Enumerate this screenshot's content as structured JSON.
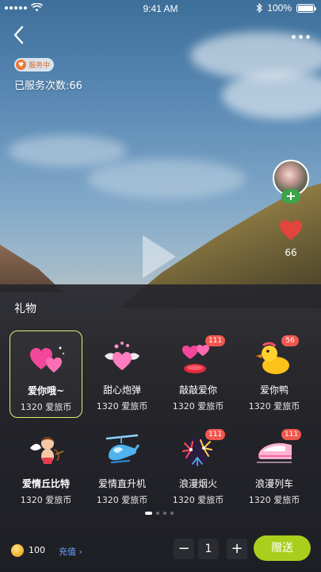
{
  "status_bar": {
    "time": "9:41 AM",
    "battery": "100%"
  },
  "profile": {
    "service_badge": "服务中",
    "service_count_label": "已服务次数:",
    "service_count": "66",
    "follow_symbol": "+",
    "like_count": "66"
  },
  "gift_panel": {
    "title": "礼物",
    "gifts": [
      {
        "name": "爱你哦~",
        "price": "1320 爱旅币",
        "icon": "double-heart-icon",
        "badge": "",
        "selected": true
      },
      {
        "name": "甜心炮弹",
        "price": "1320 爱旅币",
        "icon": "winged-heart-icon",
        "badge": ""
      },
      {
        "name": "敲敲爱你",
        "price": "1320 爱旅币",
        "icon": "heart-balloon-icon",
        "badge": "111"
      },
      {
        "name": "爱你鸭",
        "price": "1320 爱旅币",
        "icon": "duck-icon",
        "badge": "56"
      },
      {
        "name": "爱情丘比特",
        "price": "1320 爱旅币",
        "icon": "cupid-icon",
        "badge": ""
      },
      {
        "name": "爱情直升机",
        "price": "1320 爱旅币",
        "icon": "helicopter-icon",
        "badge": ""
      },
      {
        "name": "浪漫烟火",
        "price": "1320 爱旅币",
        "icon": "fireworks-icon",
        "badge": "111"
      },
      {
        "name": "浪漫列车",
        "price": "1320 爱旅币",
        "icon": "train-icon",
        "badge": "111"
      }
    ],
    "page_count": 4,
    "current_page": 1
  },
  "bottom_bar": {
    "coin_balance": "100",
    "recharge_label": "充值 ›",
    "minus_label": "−",
    "quantity": "1",
    "plus_label": "+",
    "send_label": "赠送"
  },
  "colors": {
    "accent": "#a9cf1c",
    "badge": "#f2574f",
    "follow": "#3aa54a",
    "link": "#6aa2ff"
  }
}
